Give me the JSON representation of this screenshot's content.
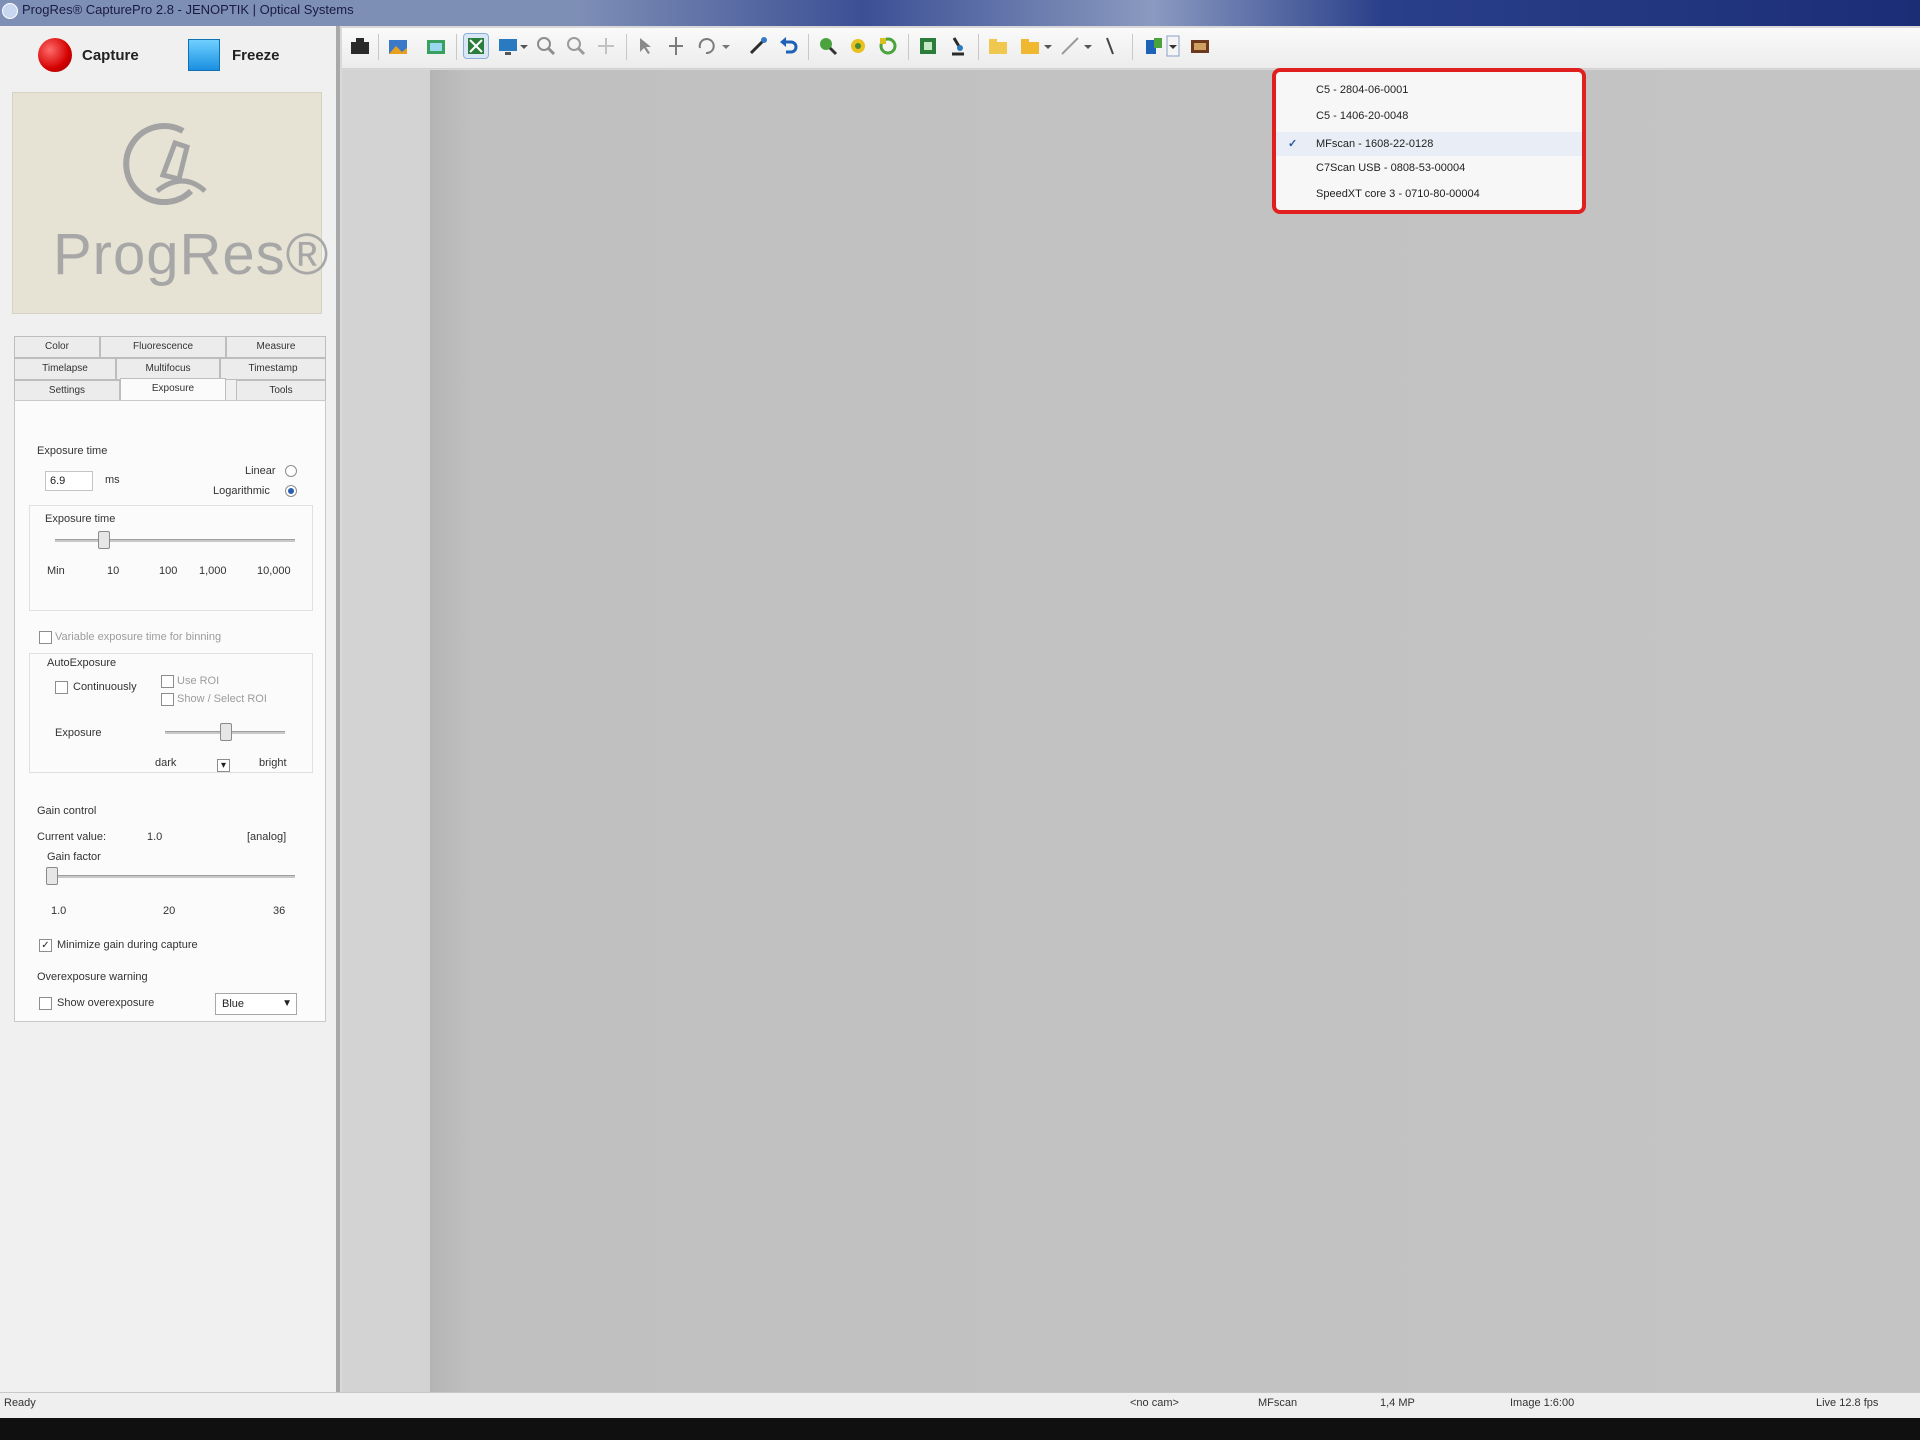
{
  "window": {
    "title": "ProgRes® CapturePro 2.8 - JENOPTIK | Optical Systems"
  },
  "capture_panel": {
    "capture_label": "Capture",
    "freeze_label": "Freeze",
    "logo_text": "ProgRes®"
  },
  "tabs": {
    "row1": [
      "Color",
      "Fluorescence",
      "Measure"
    ],
    "row2": [
      "Timelapse",
      "Multifocus",
      "Timestamp"
    ],
    "row3": [
      "Settings",
      "Exposure",
      "Tools"
    ],
    "active": "Exposure"
  },
  "exposure": {
    "section_title": "Exposure time",
    "value": "6.9",
    "unit": "ms",
    "linear_label": "Linear",
    "log_label": "Logarithmic",
    "slider_label": "Exposure time",
    "ticks": [
      "Min",
      "10",
      "100",
      "1,000",
      "10,000"
    ],
    "slider_level": 0.2,
    "variable_label": "Variable exposure time for binning",
    "auto_title": "AutoExposure",
    "continuously_label": "Continuously",
    "use_roi_label": "Use ROI",
    "show_roi_label": "Show / Select ROI",
    "exposure_label": "Exposure",
    "dark_label": "dark",
    "bright_label": "bright",
    "exposure_level": 0.5
  },
  "gain": {
    "section_title": "Gain control",
    "current_label": "Current value:",
    "current_value": "1.0",
    "mode": "[analog]",
    "factor_label": "Gain factor",
    "ticks": [
      "1.0",
      "20",
      "36"
    ],
    "level": 0.0,
    "minimize_label": "Minimize gain during capture",
    "minimize_checked": true
  },
  "overexposure": {
    "section_title": "Overexposure warning",
    "show_label": "Show overexposure",
    "color_value": "Blue"
  },
  "camera_menu": {
    "items": [
      "C5 - 2804-06-0001",
      "C5 - 1406-20-0048",
      "MFscan - 1608-22-0128",
      "C7Scan USB - 0808-53-00004",
      "SpeedXT core 3 - 0710-80-00004"
    ],
    "checked_index": 2,
    "highlight_color": "#e0201f"
  },
  "statusbar": {
    "ready": "Ready",
    "pane1": "<no cam>",
    "pane2": "MFscan",
    "pane3": "1,4 MP",
    "pane4": "Image 1:6:00",
    "pane5": "Live 12.8 fps"
  }
}
